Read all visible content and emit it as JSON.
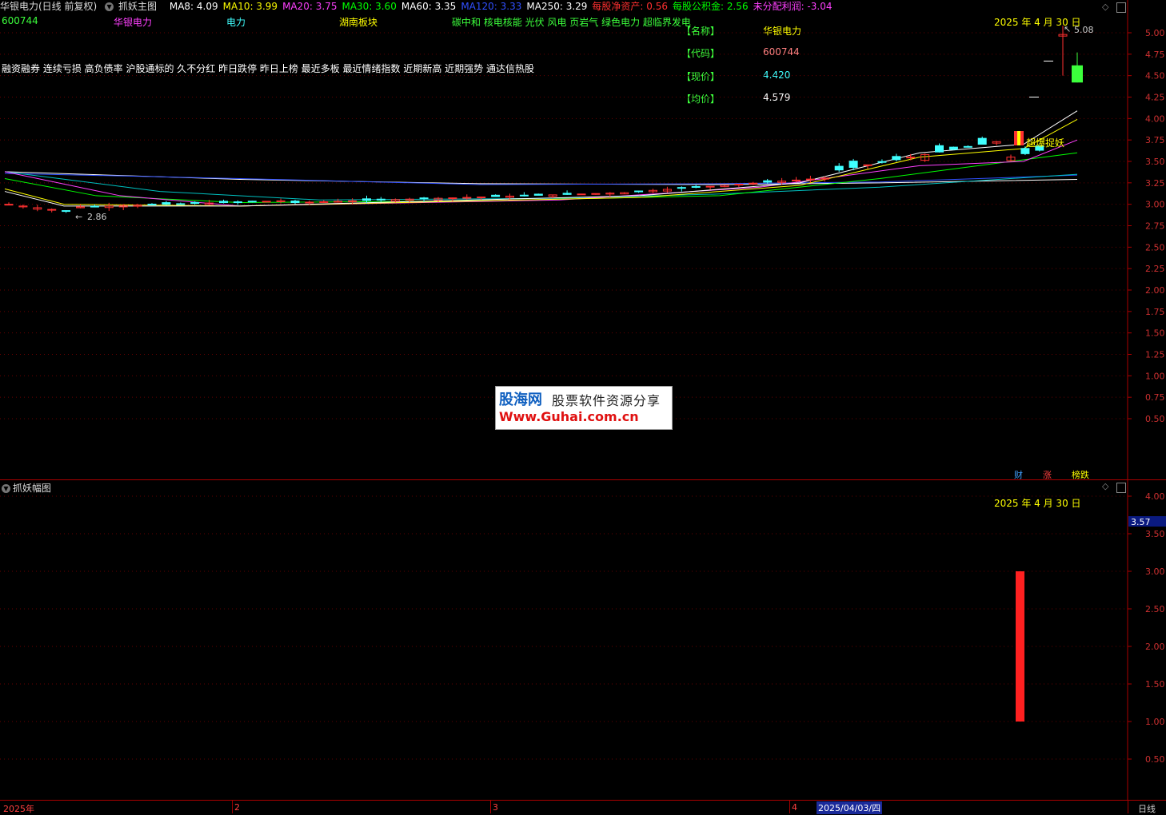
{
  "header": {
    "stock_title": "华银电力(日线 前复权)",
    "indicator_name": "抓妖主图",
    "items": [
      {
        "text": "MA8: 4.09",
        "color": "#ffffff"
      },
      {
        "text": "MA10: 3.99",
        "color": "#ffff00"
      },
      {
        "text": "MA20: 3.75",
        "color": "#ff40ff"
      },
      {
        "text": "MA30: 3.60",
        "color": "#00ff00"
      },
      {
        "text": "MA60: 3.35",
        "color": "#ffffff"
      },
      {
        "text": "MA120: 3.33",
        "color": "#3050ff"
      },
      {
        "text": "MA250: 3.29",
        "color": "#ffffff"
      },
      {
        "text": "每股净资产: 0.56",
        "color": "#ff3030"
      },
      {
        "text": "每股公积金: 2.56",
        "color": "#00ff00"
      },
      {
        "text": "未分配利润: -3.04",
        "color": "#ff40ff"
      }
    ]
  },
  "row2": {
    "code": "600744",
    "name": "华银电力",
    "industry": "电力",
    "region": "湖南板块",
    "concepts": "碳中和 核电核能 光伏 风电 页岩气 绿色电力 超临界发电"
  },
  "tags_line": "融资融券 连续亏损 高负债率 沪股通标的 久不分红 昨日跌停 昨日上榜 最近多板 最近情绪指数 近期新高 近期强势 通达信热股",
  "info_panel": [
    {
      "label": "【名称】",
      "value": "华银电力",
      "color": "#ffff00"
    },
    {
      "label": "【代码】",
      "value": "600744",
      "color": "#ff8080"
    },
    {
      "label": "【现价】",
      "value": "4.420",
      "color": "#40ffff"
    },
    {
      "label": "【均价】",
      "value": "4.579",
      "color": "#ffffff"
    }
  ],
  "main_date": "2025 年 4 月 30 日",
  "sub_date": "2025 年 4 月 30 日",
  "high_label": "5.08",
  "low_label": "2.86",
  "signal_label": "超爆捉妖",
  "main_axis_ticks": [
    "5.00",
    "4.75",
    "4.50",
    "4.25",
    "4.00",
    "3.75",
    "3.50",
    "3.25",
    "3.00",
    "2.75",
    "2.50",
    "2.25",
    "2.00",
    "1.75",
    "1.50",
    "1.25",
    "1.00",
    "0.75",
    "0.50"
  ],
  "sub_axis_ticks": [
    "4.00",
    "3.50",
    "3.00",
    "2.50",
    "2.00",
    "1.50",
    "1.00",
    "0.50"
  ],
  "sub_current_value": "3.57",
  "sub_title": "抓妖幅图",
  "bottom_buttons": [
    {
      "text": "财",
      "color": "#40a0ff"
    },
    {
      "text": "涨",
      "color": "#ff4040"
    },
    {
      "text": "榜跌",
      "color": "#ffff00"
    }
  ],
  "time_axis": {
    "year_label": "2025年",
    "marks": [
      "2",
      "3",
      "4"
    ],
    "highlight": "2025/04/03/四",
    "period": "日线"
  },
  "watermark": {
    "brand": "股海网",
    "slogan": "股票软件资源分享",
    "url": "Www.Guhai.com.cn"
  },
  "sub_bar": {
    "value": 3.0,
    "base": 1.0
  },
  "colors": {
    "up": "#ff3030",
    "down": "#40ffff",
    "axis": "#aa0000",
    "grid": "#700000"
  }
}
